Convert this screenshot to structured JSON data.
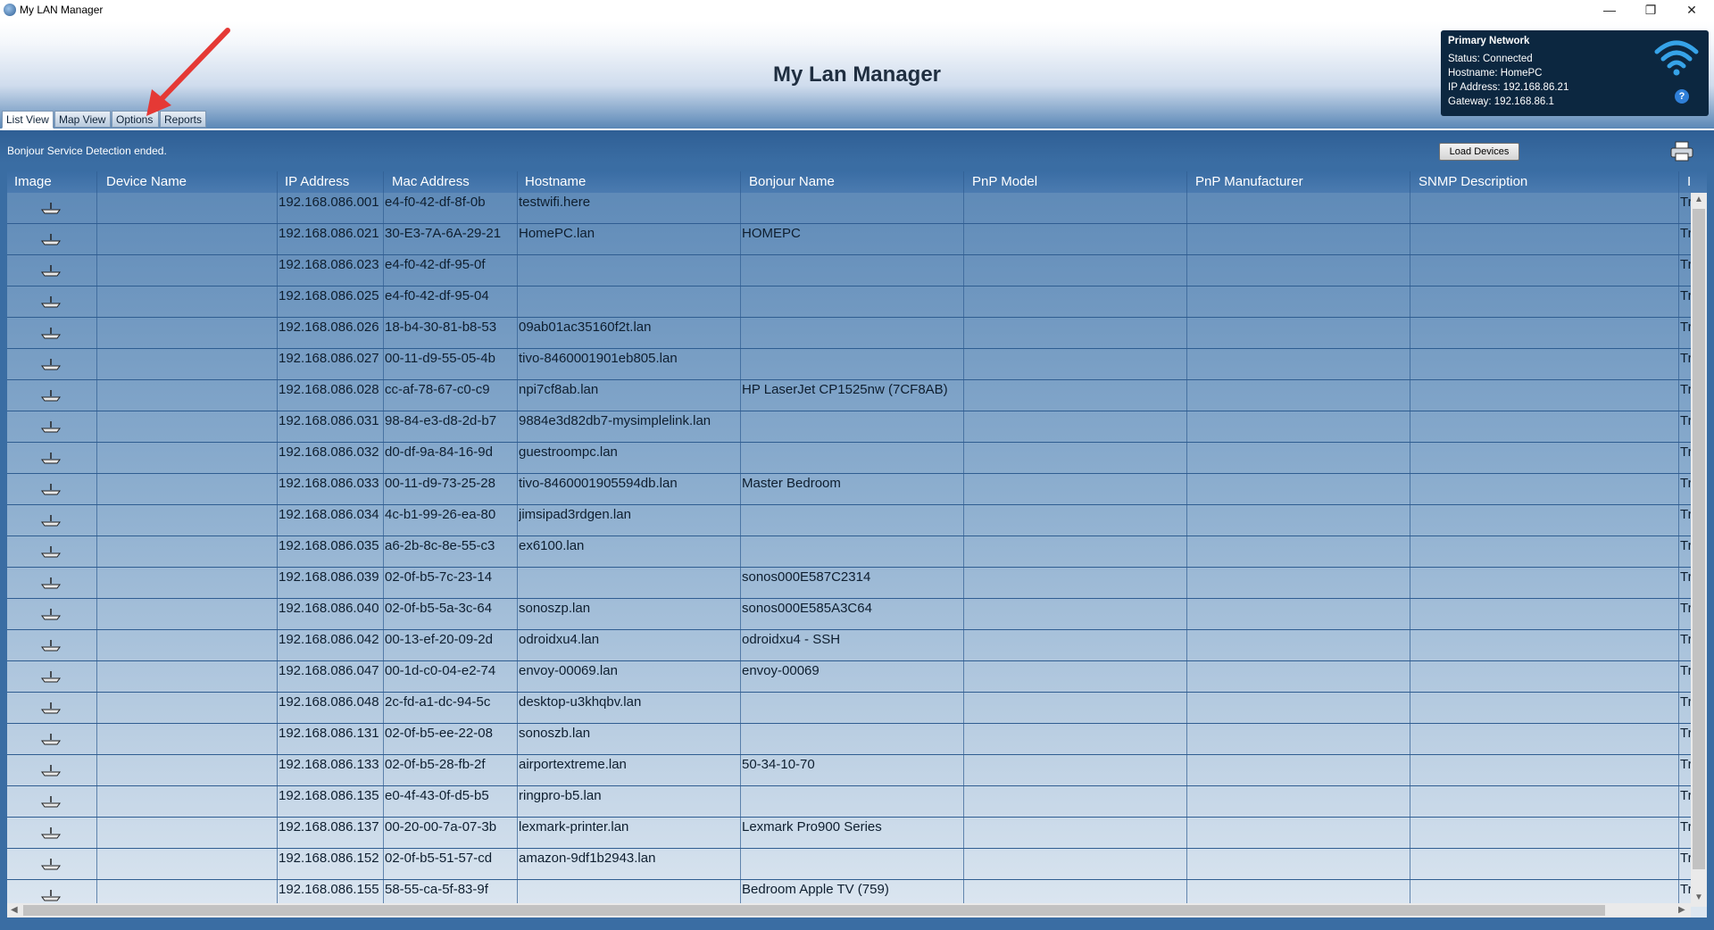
{
  "window": {
    "title": "My LAN Manager",
    "minimize": "—",
    "maximize": "❐",
    "close": "✕"
  },
  "header": {
    "title": "My Lan Manager"
  },
  "tabs": [
    {
      "label": "List View",
      "active": true
    },
    {
      "label": "Map View",
      "active": false
    },
    {
      "label": "Options",
      "active": false
    },
    {
      "label": "Reports",
      "active": false
    }
  ],
  "network": {
    "title": "Primary Network",
    "status": "Status: Connected",
    "hostname": "Hostname: HomePC",
    "ip": "IP Address: 192.168.86.21",
    "gateway": "Gateway: 192.168.86.1",
    "help": "?",
    "wifi_icon": "wifi-icon"
  },
  "status_message": "Bonjour Service Detection ended.",
  "load_button": "Load Devices",
  "table": {
    "columns": [
      "Image",
      "Device Name",
      "IP Address",
      "Mac Address",
      "Hostname",
      "Bonjour Name",
      "PnP Model",
      "PnP Manufacturer",
      "SNMP Description",
      "I"
    ],
    "rows": [
      {
        "ip": "192.168.086.001",
        "mac": "e4-f0-42-df-8f-0b",
        "host": "testwifi.here",
        "bonjour": "",
        "last": "Tr"
      },
      {
        "ip": "192.168.086.021",
        "mac": "30-E3-7A-6A-29-21",
        "host": "HomePC.lan",
        "bonjour": "HOMEPC",
        "last": "Tr"
      },
      {
        "ip": "192.168.086.023",
        "mac": "e4-f0-42-df-95-0f",
        "host": "",
        "bonjour": "",
        "last": "Tr"
      },
      {
        "ip": "192.168.086.025",
        "mac": "e4-f0-42-df-95-04",
        "host": "",
        "bonjour": "",
        "last": "Tr"
      },
      {
        "ip": "192.168.086.026",
        "mac": "18-b4-30-81-b8-53",
        "host": "09ab01ac35160f2t.lan",
        "bonjour": "",
        "last": "Tr"
      },
      {
        "ip": "192.168.086.027",
        "mac": "00-11-d9-55-05-4b",
        "host": "tivo-8460001901eb805.lan",
        "bonjour": "",
        "last": "Tr"
      },
      {
        "ip": "192.168.086.028",
        "mac": "cc-af-78-67-c0-c9",
        "host": "npi7cf8ab.lan",
        "bonjour": "HP LaserJet CP1525nw (7CF8AB)",
        "last": "Tr"
      },
      {
        "ip": "192.168.086.031",
        "mac": "98-84-e3-d8-2d-b7",
        "host": "9884e3d82db7-mysimplelink.lan",
        "bonjour": "",
        "last": "Tr"
      },
      {
        "ip": "192.168.086.032",
        "mac": "d0-df-9a-84-16-9d",
        "host": "guestroompc.lan",
        "bonjour": "",
        "last": "Tr"
      },
      {
        "ip": "192.168.086.033",
        "mac": "00-11-d9-73-25-28",
        "host": "tivo-8460001905594db.lan",
        "bonjour": "Master Bedroom",
        "last": "Tr"
      },
      {
        "ip": "192.168.086.034",
        "mac": "4c-b1-99-26-ea-80",
        "host": "jimsipad3rdgen.lan",
        "bonjour": "",
        "last": "Tr"
      },
      {
        "ip": "192.168.086.035",
        "mac": "a6-2b-8c-8e-55-c3",
        "host": "ex6100.lan",
        "bonjour": "",
        "last": "Tr"
      },
      {
        "ip": "192.168.086.039",
        "mac": "02-0f-b5-7c-23-14",
        "host": "",
        "bonjour": "sonos000E587C2314",
        "last": "Tr"
      },
      {
        "ip": "192.168.086.040",
        "mac": "02-0f-b5-5a-3c-64",
        "host": "sonoszp.lan",
        "bonjour": "sonos000E585A3C64",
        "last": "Tr"
      },
      {
        "ip": "192.168.086.042",
        "mac": "00-13-ef-20-09-2d",
        "host": "odroidxu4.lan",
        "bonjour": "odroidxu4 - SSH",
        "last": "Tr"
      },
      {
        "ip": "192.168.086.047",
        "mac": "00-1d-c0-04-e2-74",
        "host": "envoy-00069.lan",
        "bonjour": "envoy-00069",
        "last": "Tr"
      },
      {
        "ip": "192.168.086.048",
        "mac": "2c-fd-a1-dc-94-5c",
        "host": "desktop-u3khqbv.lan",
        "bonjour": "",
        "last": "Tr"
      },
      {
        "ip": "192.168.086.131",
        "mac": "02-0f-b5-ee-22-08",
        "host": "sonoszb.lan",
        "bonjour": "",
        "last": "Tr"
      },
      {
        "ip": "192.168.086.133",
        "mac": "02-0f-b5-28-fb-2f",
        "host": "airportextreme.lan",
        "bonjour": "50-34-10-70",
        "last": "Tr"
      },
      {
        "ip": "192.168.086.135",
        "mac": "e0-4f-43-0f-d5-b5",
        "host": "ringpro-b5.lan",
        "bonjour": "",
        "last": "Tr"
      },
      {
        "ip": "192.168.086.137",
        "mac": "00-20-00-7a-07-3b",
        "host": "lexmark-printer.lan",
        "bonjour": "Lexmark Pro900 Series",
        "last": "Tr"
      },
      {
        "ip": "192.168.086.152",
        "mac": "02-0f-b5-51-57-cd",
        "host": "amazon-9df1b2943.lan",
        "bonjour": "",
        "last": "Tr"
      },
      {
        "ip": "192.168.086.155",
        "mac": "58-55-ca-5f-83-9f",
        "host": "",
        "bonjour": "Bedroom Apple TV (759)",
        "last": "Tr"
      }
    ]
  },
  "colors": {
    "header_accent": "#0c2740",
    "content_bg": "#3a6da3",
    "annotation_arrow": "#e53935"
  }
}
